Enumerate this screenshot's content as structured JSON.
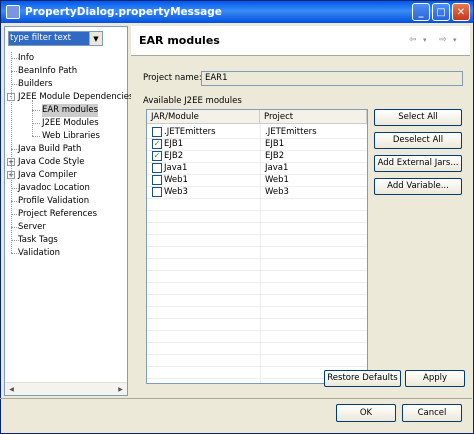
{
  "window": {
    "title": "PropertyDialog.propertyMessage",
    "min": "_",
    "max": "□",
    "close": "✕"
  },
  "filter": {
    "value": "type filter text"
  },
  "tree": [
    {
      "label": "Info"
    },
    {
      "label": "BeanInfo Path"
    },
    {
      "label": "Builders"
    },
    {
      "label": "J2EE Module Dependencies",
      "expander": "-"
    },
    {
      "label": "EAR modules",
      "selected": true
    },
    {
      "label": "J2EE Modules"
    },
    {
      "label": "Web Libraries"
    },
    {
      "label": "Java Build Path"
    },
    {
      "label": "Java Code Style",
      "expander": "+"
    },
    {
      "label": "Java Compiler",
      "expander": "+"
    },
    {
      "label": "Javadoc Location"
    },
    {
      "label": "Profile Validation"
    },
    {
      "label": "Project References"
    },
    {
      "label": "Server"
    },
    {
      "label": "Task Tags"
    },
    {
      "label": "Validation"
    }
  ],
  "page": {
    "title": "EAR modules",
    "project_label": "Project name:",
    "project_value": "EAR1",
    "modules_label": "Available J2EE modules"
  },
  "table": {
    "headers": [
      "JAR/Module",
      "Project"
    ],
    "rows": [
      {
        "checked": false,
        "module": ".JETEmitters",
        "project": ".JETEmitters"
      },
      {
        "checked": true,
        "module": "EJB1",
        "project": "EJB1"
      },
      {
        "checked": true,
        "module": "EJB2",
        "project": "EJB2"
      },
      {
        "checked": false,
        "module": "Java1",
        "project": "Java1"
      },
      {
        "checked": false,
        "module": "Web1",
        "project": "Web1"
      },
      {
        "checked": false,
        "module": "Web3",
        "project": "Web3"
      }
    ]
  },
  "buttons": {
    "select_all": "Select All",
    "deselect_all": "Deselect All",
    "add_external_jars": "Add External Jars...",
    "add_variable": "Add Variable...",
    "restore_defaults": "Restore Defaults",
    "apply": "Apply",
    "ok": "OK",
    "cancel": "Cancel"
  },
  "nav": {
    "back": "⇦",
    "forward": "⇨",
    "dropdown": "▾"
  }
}
